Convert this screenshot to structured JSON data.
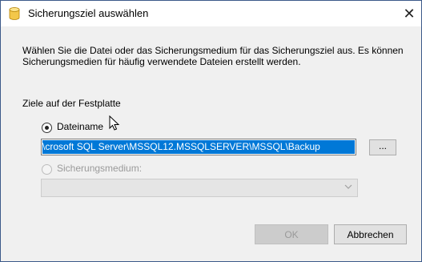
{
  "window": {
    "title": "Sicherungsziel auswählen",
    "close_glyph": "✕"
  },
  "description": "Wählen Sie die Datei oder das Sicherungsmedium für das Sicherungsziel aus. Es können Sicherungsmedien für häufig verwendete Dateien erstellt werden.",
  "group_label": "Ziele auf der Festplatte",
  "options": {
    "filename": {
      "label": "Dateiname",
      "selected": true
    },
    "backup_device": {
      "label": "Sicherungsmedium:",
      "selected": false,
      "enabled": false
    }
  },
  "path_value": "crosoft SQL Server\\MSSQL12.MSSQLSERVER\\MSSQL\\Backup\\",
  "browse_label": "...",
  "buttons": {
    "ok": "OK",
    "cancel": "Abbrechen"
  },
  "colors": {
    "selection": "#0078d7",
    "window_bg": "#f0f0f0",
    "border": "#3c5a8a"
  },
  "icons": {
    "title": "database-icon",
    "dropdown": "chevron-down-icon"
  }
}
